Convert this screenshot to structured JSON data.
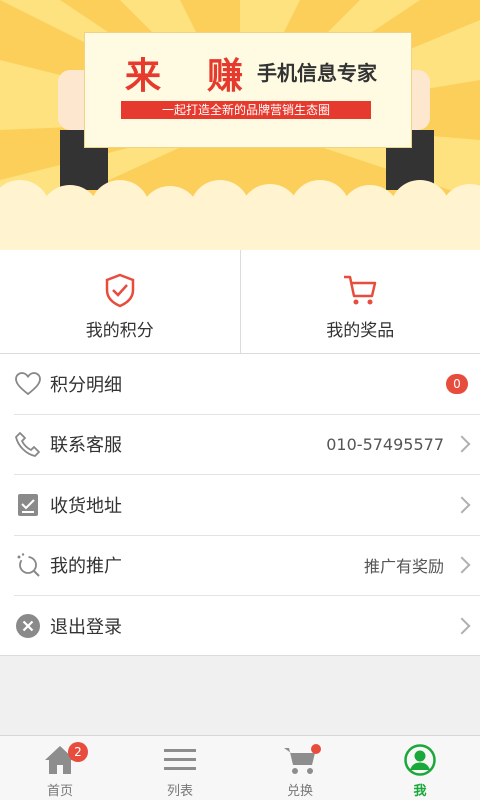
{
  "banner": {
    "char1": "来",
    "char2": "赚",
    "subtitle": "手机信息专家",
    "slogan": "一起打造全新的品牌营销生态圈"
  },
  "cards": [
    {
      "label": "我的积分",
      "icon": "shield-check-icon"
    },
    {
      "label": "我的奖品",
      "icon": "cart-icon"
    }
  ],
  "menu": [
    {
      "label": "积分明细",
      "icon": "heart-icon",
      "badge": "0",
      "value": ""
    },
    {
      "label": "联系客服",
      "icon": "phone-icon",
      "value": "010-57495577"
    },
    {
      "label": "收货地址",
      "icon": "address-icon",
      "value": ""
    },
    {
      "label": "我的推广",
      "icon": "promote-icon",
      "value": "推广有奖励"
    },
    {
      "label": "退出登录",
      "icon": "logout-icon",
      "value": ""
    }
  ],
  "nav": [
    {
      "label": "首页",
      "icon": "home-icon",
      "badge": "2"
    },
    {
      "label": "列表",
      "icon": "list-icon"
    },
    {
      "label": "兑换",
      "icon": "exchange-cart-icon"
    },
    {
      "label": "我",
      "icon": "user-icon",
      "active": true
    }
  ],
  "colors": {
    "accent": "#e63a2e",
    "active": "#1aa83a",
    "banner": "#fbcf5a"
  }
}
